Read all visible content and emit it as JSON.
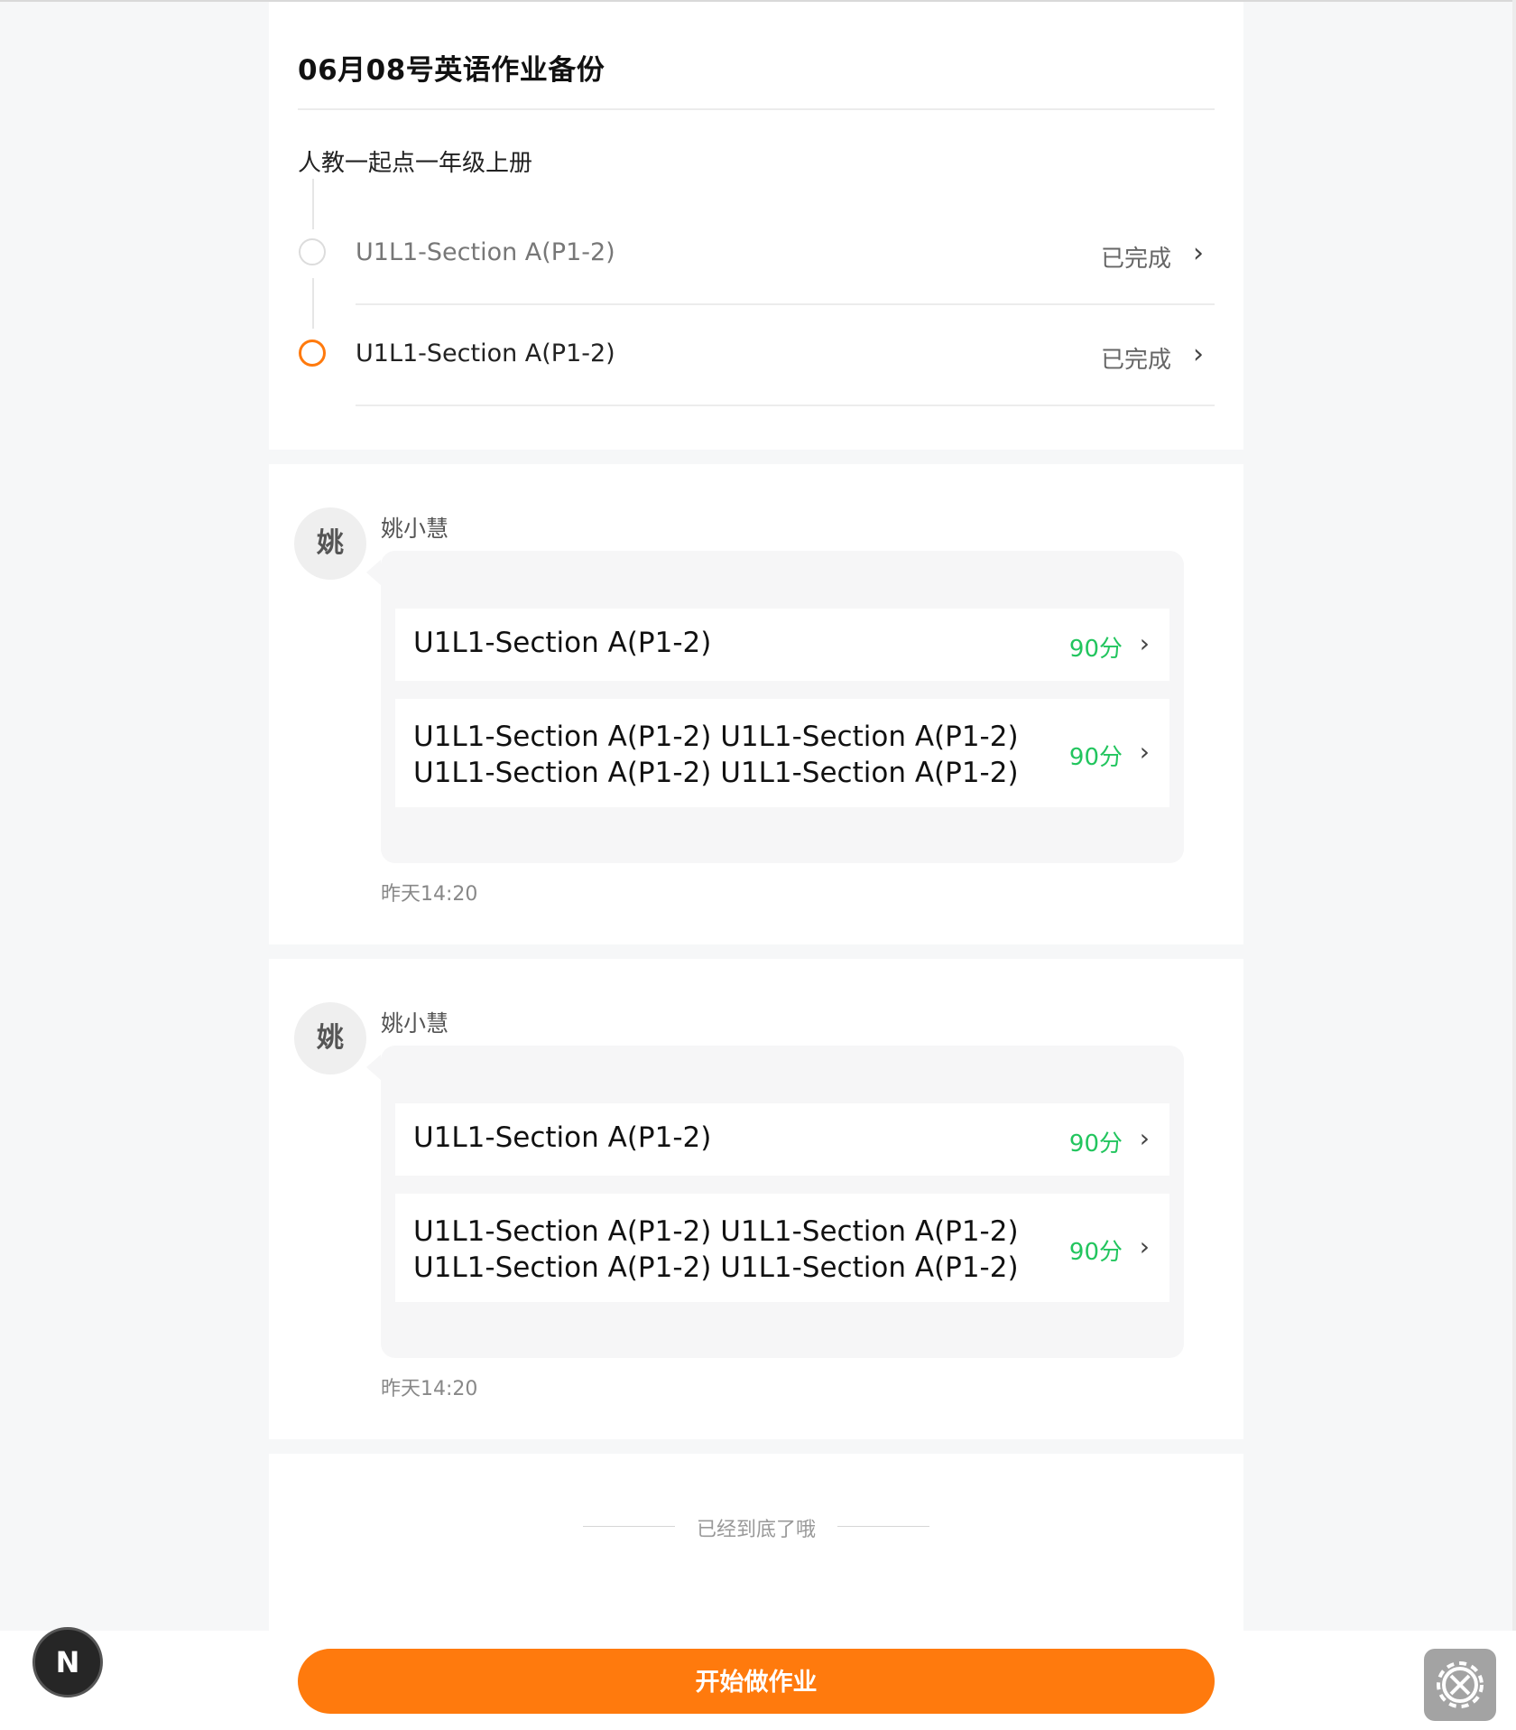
{
  "header": {
    "title": "06月08号英语作业备份",
    "book": "人教一起点一年级上册",
    "sections": [
      {
        "name": "U1L1-Section A(P1-2)",
        "status": "已完成",
        "marker": "grey"
      },
      {
        "name": "U1L1-Section A(P1-2)",
        "status": "已完成",
        "marker": "orange"
      }
    ]
  },
  "messages": [
    {
      "avatar": "姚",
      "sender": "姚小慧",
      "items": [
        {
          "title": "U1L1-Section A(P1-2)",
          "score": "90分"
        },
        {
          "title": "U1L1-Section A(P1-2) U1L1-Section A(P1-2) U1L1-Section A(P1-2) U1L1-Section A(P1-2)",
          "score": "90分"
        }
      ],
      "time": "昨天14:20"
    },
    {
      "avatar": "姚",
      "sender": "姚小慧",
      "items": [
        {
          "title": "U1L1-Section A(P1-2)",
          "score": "90分"
        },
        {
          "title": "U1L1-Section A(P1-2) U1L1-Section A(P1-2) U1L1-Section A(P1-2) U1L1-Section A(P1-2)",
          "score": "90分"
        }
      ],
      "time": "昨天14:20"
    }
  ],
  "footer": {
    "end_text": "已经到底了哦",
    "cta": "开始做作业",
    "badge": "N"
  },
  "colors": {
    "accent": "#ff7a0d",
    "score": "#22c55e",
    "background": "#f6f7f8"
  },
  "icons": [
    "chevron-right-icon",
    "settings-gear-icon"
  ]
}
